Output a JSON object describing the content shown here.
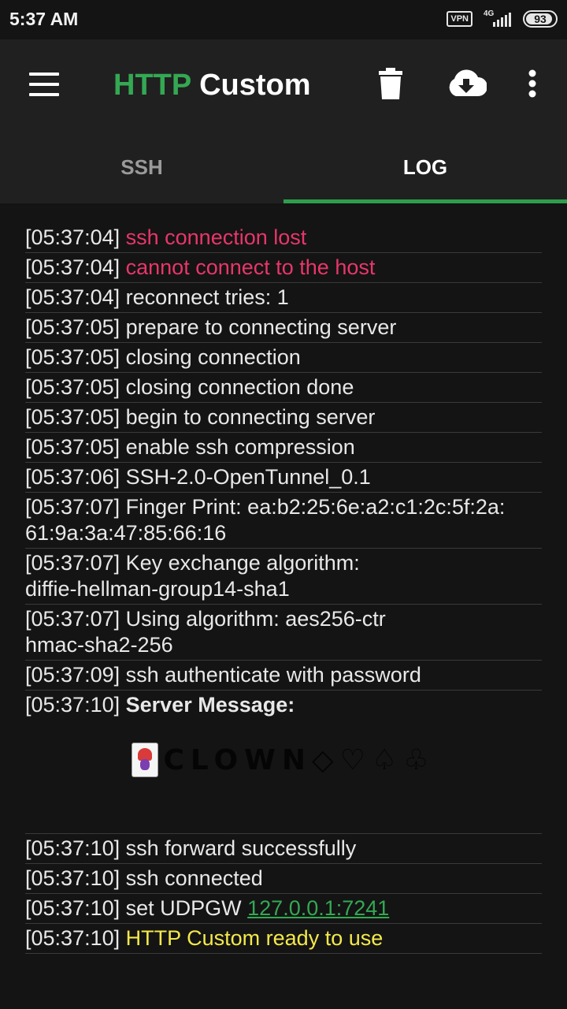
{
  "status_bar": {
    "time": "5:37 AM",
    "vpn": "VPN",
    "network": "4G",
    "battery": "93"
  },
  "app_bar": {
    "title_part1": "HTTP",
    "title_part2": "Custom",
    "icons": [
      "menu-icon",
      "trash-icon",
      "cloud-download-icon",
      "more-vert-icon"
    ]
  },
  "tabs": [
    {
      "label": "SSH",
      "active": false
    },
    {
      "label": "LOG",
      "active": true
    }
  ],
  "colors": {
    "accent_green": "#34a853",
    "error_red": "#e8366a",
    "ready_yellow": "#f4e94a"
  },
  "log": [
    {
      "ts": "[05:37:04]",
      "msg": "ssh connection lost",
      "style": "red"
    },
    {
      "ts": "[05:37:04]",
      "msg": "cannot connect to the host",
      "style": "red"
    },
    {
      "ts": "[05:37:04]",
      "msg": "reconnect tries: 1"
    },
    {
      "ts": "[05:37:05]",
      "msg": "prepare to connecting server"
    },
    {
      "ts": "[05:37:05]",
      "msg": "closing connection"
    },
    {
      "ts": "[05:37:05]",
      "msg": "closing connection done"
    },
    {
      "ts": "[05:37:05]",
      "msg": "begin to connecting server"
    },
    {
      "ts": "[05:37:05]",
      "msg": "enable ssh compression"
    },
    {
      "ts": "[05:37:06]",
      "msg": "SSH-2.0-OpenTunnel_0.1"
    },
    {
      "ts": "[05:37:07]",
      "msg": "Finger Print: ea:b2:25:6e:a2:c1:2c:5f:2a:\n61:9a:3a:47:85:66:16"
    },
    {
      "ts": "[05:37:07]",
      "msg": "Key exchange algorithm:\ndiffie-hellman-group14-sha1"
    },
    {
      "ts": "[05:37:07]",
      "msg": "Using algorithm: aes256-ctr\nhmac-sha2-256"
    },
    {
      "ts": "[05:37:09]",
      "msg": "ssh authenticate with password"
    },
    {
      "ts": "[05:37:10]",
      "msg": "Server Message:",
      "style": "bold"
    }
  ],
  "server_message": "CLOWN◇♡♤♧",
  "log_after": [
    {
      "ts": "[05:37:10]",
      "msg": "ssh forward successfully"
    },
    {
      "ts": "[05:37:10]",
      "msg": "ssh connected"
    },
    {
      "ts": "[05:37:10]",
      "msg": "set UDPGW ",
      "link": "127.0.0.1:7241"
    },
    {
      "ts": "[05:37:10]",
      "msg": "HTTP Custom ready to use",
      "style": "yellow"
    }
  ]
}
